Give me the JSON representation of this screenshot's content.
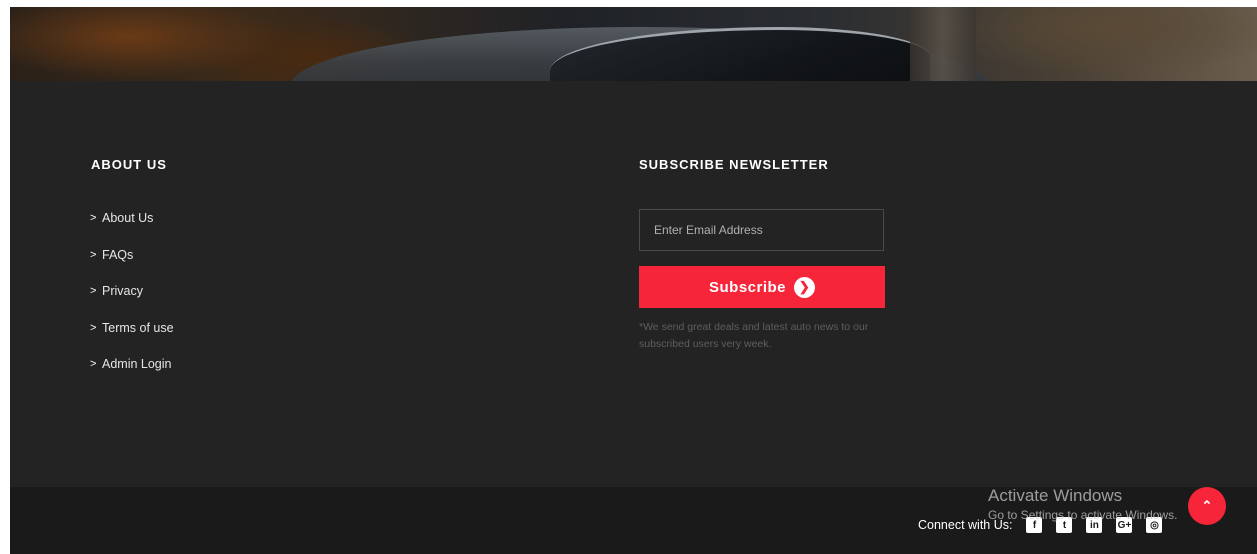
{
  "about": {
    "title": "ABOUT US",
    "links": [
      {
        "label": "About Us",
        "icon": "chevron-right-icon"
      },
      {
        "label": "FAQs",
        "icon": "chevron-right-icon"
      },
      {
        "label": "Privacy",
        "icon": "chevron-right-icon"
      },
      {
        "label": "Terms of use",
        "icon": "chevron-right-icon"
      },
      {
        "label": "Admin Login",
        "icon": "chevron-right-icon"
      }
    ]
  },
  "newsletter": {
    "title": "SUBSCRIBE NEWSLETTER",
    "email_placeholder": "Enter Email Address",
    "email_value": "",
    "subscribe_label": "Subscribe",
    "note": "*We send great deals and latest auto news to our subscribed users very week."
  },
  "footer_bottom": {
    "connect_label": "Connect with Us:",
    "social_icons": [
      "facebook-icon",
      "twitter-icon",
      "linkedin-icon",
      "google-plus-icon",
      "instagram-icon"
    ]
  },
  "watermark": {
    "line1": "Activate Windows",
    "line2": "Go to Settings to activate Windows."
  },
  "colors": {
    "accent": "#f7253a",
    "footer_bg": "#232323",
    "footer_bottom_bg": "#1a1a1a"
  }
}
